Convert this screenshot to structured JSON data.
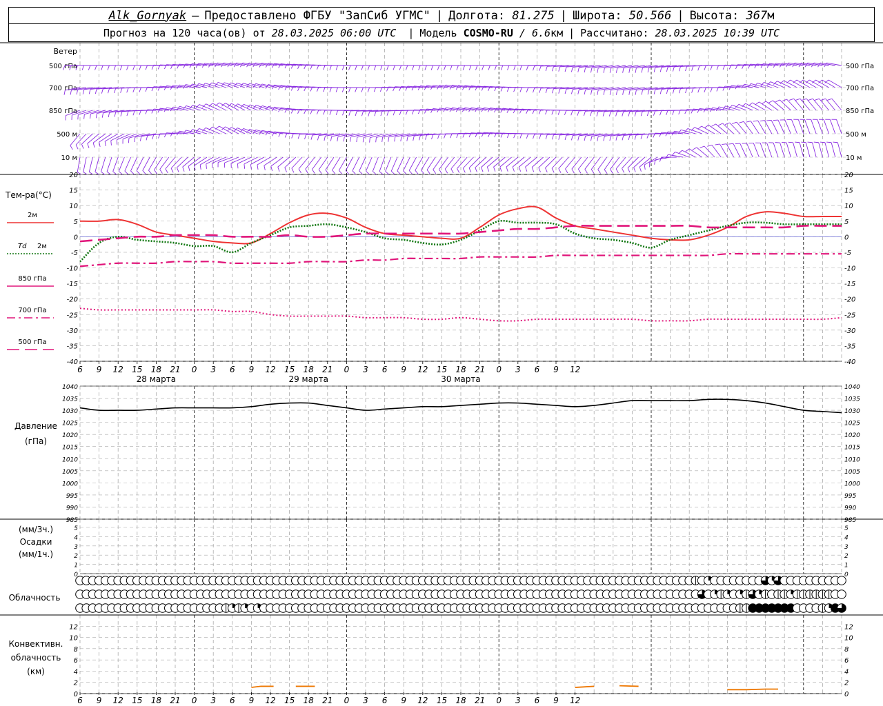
{
  "header": {
    "station": "Alk_Gornyak",
    "dash": "–",
    "provider": "Предоставлено ФГБУ \"ЗапСиб УГМС\"",
    "lon_label": "Долгота:",
    "lon_value": "81.275",
    "lat_label": "Широта:",
    "lat_value": "50.566",
    "alt_label": "Высота:",
    "alt_value": "367",
    "alt_unit": "м",
    "forecast_text": "Прогноз на 120 часа(ов) от",
    "forecast_start": "28.03.2025 06:00 UTC",
    "model_label": "Модель",
    "model_name": "COSMO-RU",
    "model_res_sep": "/",
    "model_res": "6.6",
    "model_res_unit": "км",
    "calc_label": "Рассчитано:",
    "calc_time": "28.03.2025 10:39 UTC"
  },
  "colors": {
    "wind": "#8a2be2",
    "t2m": "#ee3333",
    "td2m": "#117711",
    "t850": "#e0157a",
    "t700": "#e0157a",
    "t500": "#e0157a",
    "pressure": "#000000",
    "conv": "#ee7700",
    "grid": "#aaaaaa"
  },
  "chart_data": [
    {
      "type": "wind_barbs",
      "title": "Ветер",
      "levels": [
        "500 гПа",
        "700 гПа",
        "850 гПа",
        "500 м",
        "10  м"
      ],
      "note": "wind barbs every 3 h; direction in degrees (from)",
      "samples_hour": [
        0,
        6,
        12,
        18,
        24,
        30,
        36,
        42,
        48,
        54,
        60,
        66,
        72,
        78,
        84,
        90,
        96,
        102,
        108,
        114
      ],
      "direction_deg": {
        "500 гПа": [
          270,
          270,
          270,
          275,
          280,
          280,
          275,
          270,
          270,
          270,
          270,
          270,
          270,
          265,
          260,
          260,
          265,
          270,
          275,
          280
        ],
        "700 гПа": [
          260,
          265,
          270,
          280,
          290,
          285,
          275,
          270,
          270,
          275,
          280,
          275,
          270,
          265,
          260,
          260,
          265,
          270,
          285,
          300
        ],
        "850 гПа": [
          250,
          260,
          270,
          285,
          300,
          290,
          275,
          270,
          265,
          270,
          280,
          280,
          275,
          270,
          265,
          265,
          270,
          280,
          300,
          320
        ],
        "500 м": [
          220,
          240,
          260,
          280,
          300,
          285,
          270,
          260,
          255,
          260,
          270,
          275,
          270,
          265,
          260,
          265,
          280,
          310,
          330,
          340
        ],
        "10  м": [
          190,
          200,
          210,
          230,
          250,
          240,
          220,
          210,
          200,
          210,
          220,
          230,
          230,
          220,
          215,
          230,
          290,
          330,
          340,
          345
        ]
      }
    },
    {
      "type": "line",
      "ylabel": "Тем-ра(°С)",
      "ylim": [
        -40,
        20
      ],
      "yticks": [
        -40,
        -35,
        -30,
        -25,
        -20,
        -15,
        -10,
        -5,
        0,
        5,
        10,
        15,
        20
      ],
      "x_hours": [
        0,
        3,
        6,
        9,
        12,
        15,
        18,
        21,
        24,
        27,
        30,
        33,
        36,
        39,
        42,
        45,
        48,
        51,
        54,
        57,
        60,
        63,
        66,
        69,
        72,
        75,
        78,
        81,
        84,
        87,
        90,
        93,
        96,
        99,
        102,
        105,
        108,
        111,
        114,
        117,
        120
      ],
      "series": [
        {
          "name": "2м",
          "key": "t2m",
          "dash": "solid",
          "values": [
            5,
            5,
            5.5,
            4,
            1.5,
            0.5,
            -0.5,
            -1.5,
            -2,
            -2,
            1,
            4.5,
            7,
            7.5,
            6,
            3,
            1,
            0.5,
            0,
            -0.5,
            -0.5,
            3,
            7,
            9,
            9.5,
            6,
            3.5,
            2.5,
            1.5,
            0.5,
            -0.5,
            -1,
            -1,
            0.5,
            3,
            6.5,
            8,
            7.5,
            6.5,
            6.5,
            6.5
          ]
        },
        {
          "name": "Td  2м",
          "key": "td2m",
          "dash": "dotted",
          "values": [
            -8,
            -2,
            0,
            -1,
            -1.5,
            -2,
            -3,
            -3,
            -5,
            -2,
            0.5,
            3,
            3.5,
            4,
            3,
            1.5,
            -0.5,
            -1,
            -2,
            -2.5,
            -1,
            2,
            5,
            4.5,
            4.5,
            4,
            1,
            -0.5,
            -1,
            -2,
            -3.5,
            -1,
            0.5,
            2,
            3.5,
            4.5,
            4.5,
            4,
            4,
            4,
            4
          ]
        },
        {
          "name": "850 гПа",
          "key": "t850",
          "dash": "longdash",
          "values": [
            -1.5,
            -1,
            -0.5,
            0,
            0,
            0.5,
            0.5,
            0.5,
            0,
            0,
            0,
            0.5,
            0,
            0,
            0.5,
            1,
            1,
            1,
            1,
            1,
            1,
            1.5,
            2,
            2.5,
            2.5,
            3,
            3.5,
            3.5,
            3.5,
            3.5,
            3.5,
            3.5,
            3.5,
            3,
            3,
            3,
            3,
            3,
            3.5,
            3.5,
            3.5
          ]
        },
        {
          "name": "700 гПа",
          "key": "t700",
          "dash": "dashdot",
          "values": [
            -9.5,
            -9,
            -8.5,
            -8.5,
            -8.5,
            -8,
            -8,
            -8,
            -8.5,
            -8.5,
            -8.5,
            -8.5,
            -8,
            -8,
            -8,
            -7.5,
            -7.5,
            -7,
            -7,
            -7,
            -7,
            -6.5,
            -6.5,
            -6.5,
            -6.5,
            -6,
            -6,
            -6,
            -6,
            -6,
            -6,
            -6,
            -6,
            -6,
            -5.5,
            -5.5,
            -5.5,
            -5.5,
            -5.5,
            -5.5,
            -5.5
          ]
        },
        {
          "name": "500 гПа",
          "key": "t500",
          "dash": "fine",
          "values": [
            -23,
            -23.5,
            -23.5,
            -23.5,
            -23.5,
            -23.5,
            -23.5,
            -23.5,
            -24,
            -24,
            -25,
            -25.5,
            -25.5,
            -25.5,
            -25.5,
            -26,
            -26,
            -26,
            -26.5,
            -26.5,
            -26,
            -26.5,
            -27,
            -27,
            -26.5,
            -26.5,
            -26.5,
            -26.5,
            -26.5,
            -26.5,
            -27,
            -27,
            -27,
            -26.5,
            -26.5,
            -26.5,
            -26.5,
            -26.5,
            -26.5,
            -26.5,
            -26
          ]
        }
      ]
    },
    {
      "type": "line",
      "ylabel": "Давление",
      "yunit": "(гПа)",
      "ylim": [
        985,
        1040
      ],
      "yticks": [
        985,
        990,
        995,
        1000,
        1005,
        1010,
        1015,
        1020,
        1025,
        1030,
        1035,
        1040
      ],
      "x_hours": [
        0,
        3,
        6,
        9,
        12,
        15,
        18,
        21,
        24,
        27,
        30,
        33,
        36,
        39,
        42,
        45,
        48,
        51,
        54,
        57,
        60,
        63,
        66,
        69,
        72,
        75,
        78,
        81,
        84,
        87,
        90,
        93,
        96,
        99,
        102,
        105,
        108,
        111,
        114,
        117,
        120
      ],
      "series": [
        {
          "name": "Давление",
          "key": "pressure",
          "values": [
            1031,
            1030,
            1030,
            1030,
            1030.5,
            1031,
            1031,
            1031,
            1031,
            1031.5,
            1032.5,
            1033,
            1033,
            1032,
            1031,
            1030,
            1030.5,
            1031,
            1031.5,
            1031.5,
            1032,
            1032.5,
            1033,
            1033,
            1032.5,
            1032,
            1031.5,
            1032,
            1033,
            1034,
            1034,
            1034,
            1034,
            1034.5,
            1034.5,
            1034,
            1033,
            1031.5,
            1030,
            1029.5,
            1029
          ]
        }
      ]
    },
    {
      "type": "bar",
      "ylabel": "Осадки",
      "yunit_top": "(мм/3ч.)",
      "yunit_bottom": "(мм/1ч.)",
      "ylim": [
        0,
        5
      ],
      "yticks": [
        0,
        1,
        2,
        3,
        4,
        5
      ],
      "values": []
    },
    {
      "type": "cloud_symbols",
      "ylabel": "Облачность",
      "step_hours": 1,
      "rows": [
        {
          "level": "upper",
          "nonzero": {
            "97": 1,
            "99": 2,
            "108": 3,
            "109": 2,
            "110": 3
          }
        },
        {
          "level": "middle",
          "nonzero": {
            "98": 3,
            "100": 2,
            "101": 1,
            "102": 2,
            "104": 2,
            "105": 1,
            "106": 3,
            "107": 2,
            "108": 1,
            "110": 1,
            "111": 1,
            "112": 2,
            "113": 1,
            "114": 1,
            "115": 1,
            "116": 1,
            "117": 1,
            "118": 1
          }
        },
        {
          "level": "lower",
          "nonzero": {
            "23": 1,
            "24": 2,
            "25": 1,
            "26": 2,
            "28": 2,
            "104": 1,
            "105": 1,
            "106": 4,
            "107": 4,
            "108": 4,
            "109": 4,
            "110": 4,
            "111": 4,
            "112": 4,
            "117": 1,
            "118": 2,
            "119": 4,
            "120": 3
          }
        }
      ]
    },
    {
      "type": "line",
      "ylabel": "Конвективн. облачность (км)",
      "ylim": [
        0,
        14
      ],
      "yticks": [
        0,
        2,
        4,
        6,
        8,
        10,
        12
      ],
      "segments": [
        {
          "x": [
            27,
            28.5,
            30.5
          ],
          "y": [
            1.1,
            1.3,
            1.3
          ]
        },
        {
          "x": [
            34,
            37
          ],
          "y": [
            1.3,
            1.3
          ]
        },
        {
          "x": [
            78,
            81
          ],
          "y": [
            1.1,
            1.3
          ]
        },
        {
          "x": [
            85,
            88
          ],
          "y": [
            1.4,
            1.3
          ]
        },
        {
          "x": [
            102,
            105,
            108,
            110
          ],
          "y": [
            0.7,
            0.7,
            0.8,
            0.8
          ]
        }
      ]
    }
  ],
  "time_axis": {
    "start_hour": 6,
    "hours_per_tick": 3,
    "tick_labels": [
      "6",
      "9",
      "12",
      "15",
      "18",
      "21",
      "0",
      "3",
      "6",
      "9",
      "12",
      "15",
      "18",
      "21",
      "0",
      "3",
      "6",
      "9",
      "12",
      "15",
      "18",
      "21",
      "0",
      "3",
      "6",
      "9",
      "12"
    ],
    "dates": [
      {
        "label": "28 марта",
        "hour": 12
      },
      {
        "label": "29 марта",
        "hour": 36
      },
      {
        "label": "30 марта",
        "hour": 60
      }
    ]
  },
  "legend": {
    "temp_title": "Тем-ра(°С)",
    "t2m": "2м",
    "td_label_a": "Td",
    "td_label_b": "2м",
    "t850": "850 гПа",
    "t700": "700 гПа",
    "t500": "500 гПа"
  }
}
